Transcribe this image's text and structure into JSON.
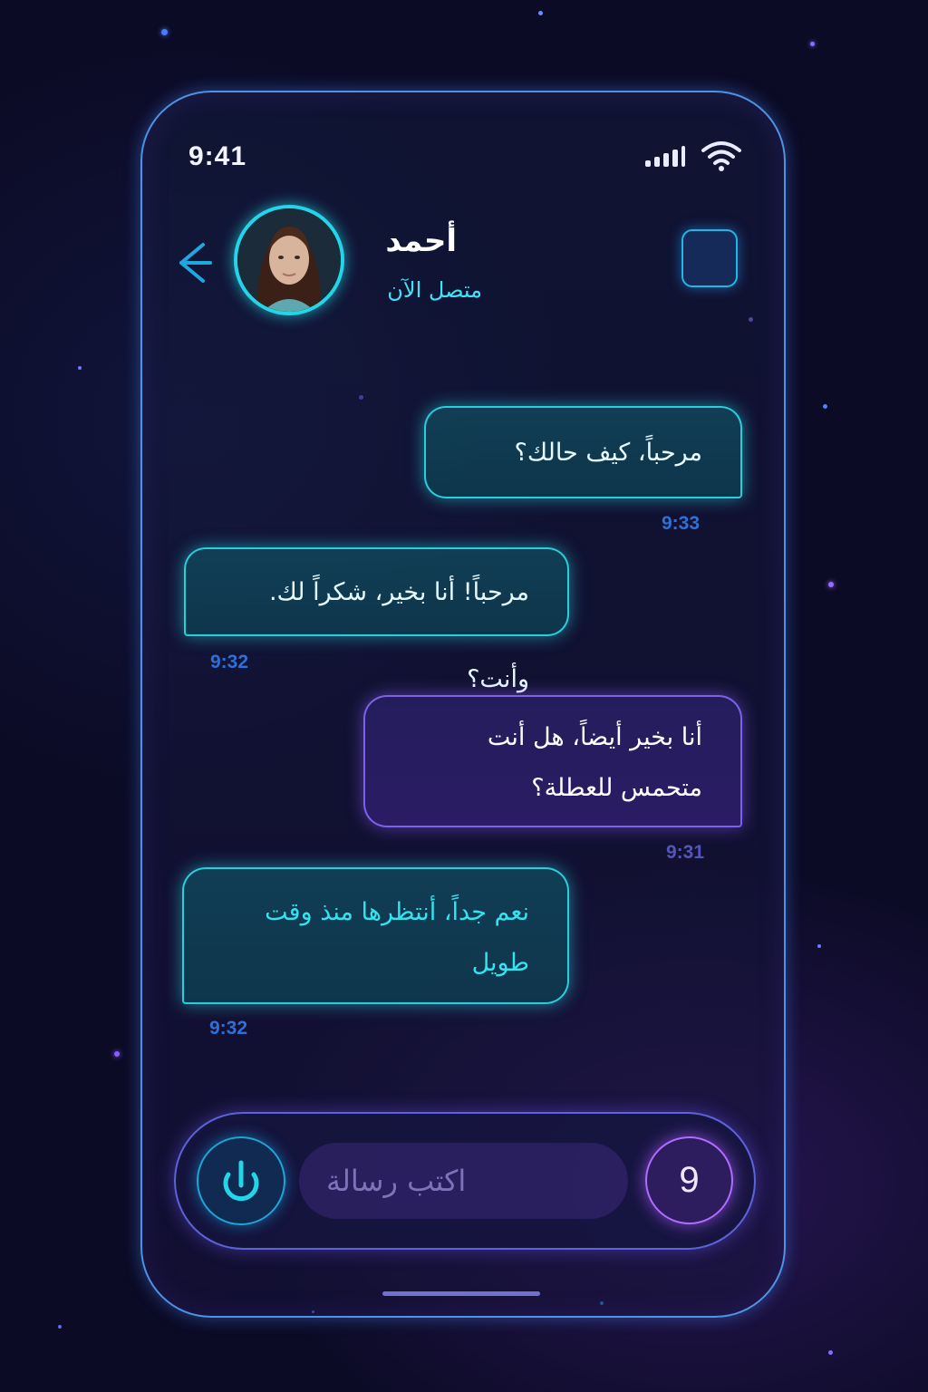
{
  "status_bar": {
    "time": "9:41",
    "signal_icon": "signal-bars-icon",
    "wifi_icon": "wifi-icon"
  },
  "header": {
    "back_icon": "chevron-left-icon",
    "contact_name": "أحمد",
    "contact_status": "متصل الآن",
    "menu_icon": "square-icon"
  },
  "messages": [
    {
      "side": "outgoing",
      "text": "مرحباً، كيف حالك؟",
      "time": "9:33"
    },
    {
      "side": "incoming",
      "text": "مرحباً! أنا بخير، شكراً لك. وأنت؟",
      "time": "9:32"
    },
    {
      "side": "outgoing",
      "text": "أنا بخير أيضاً، هل أنت متحمس للعطلة؟",
      "time": "9:31"
    },
    {
      "side": "incoming",
      "text": "نعم جداً، أنتظرها منذ وقت طويل",
      "time": "9:32"
    }
  ],
  "composer": {
    "mic_icon": "microphone-icon",
    "placeholder": "اكتب رسالة",
    "send_label": "9"
  },
  "colors": {
    "accent_cyan": "#22d6e8",
    "accent_purple": "#b06cff",
    "background": "#0c0b26"
  }
}
